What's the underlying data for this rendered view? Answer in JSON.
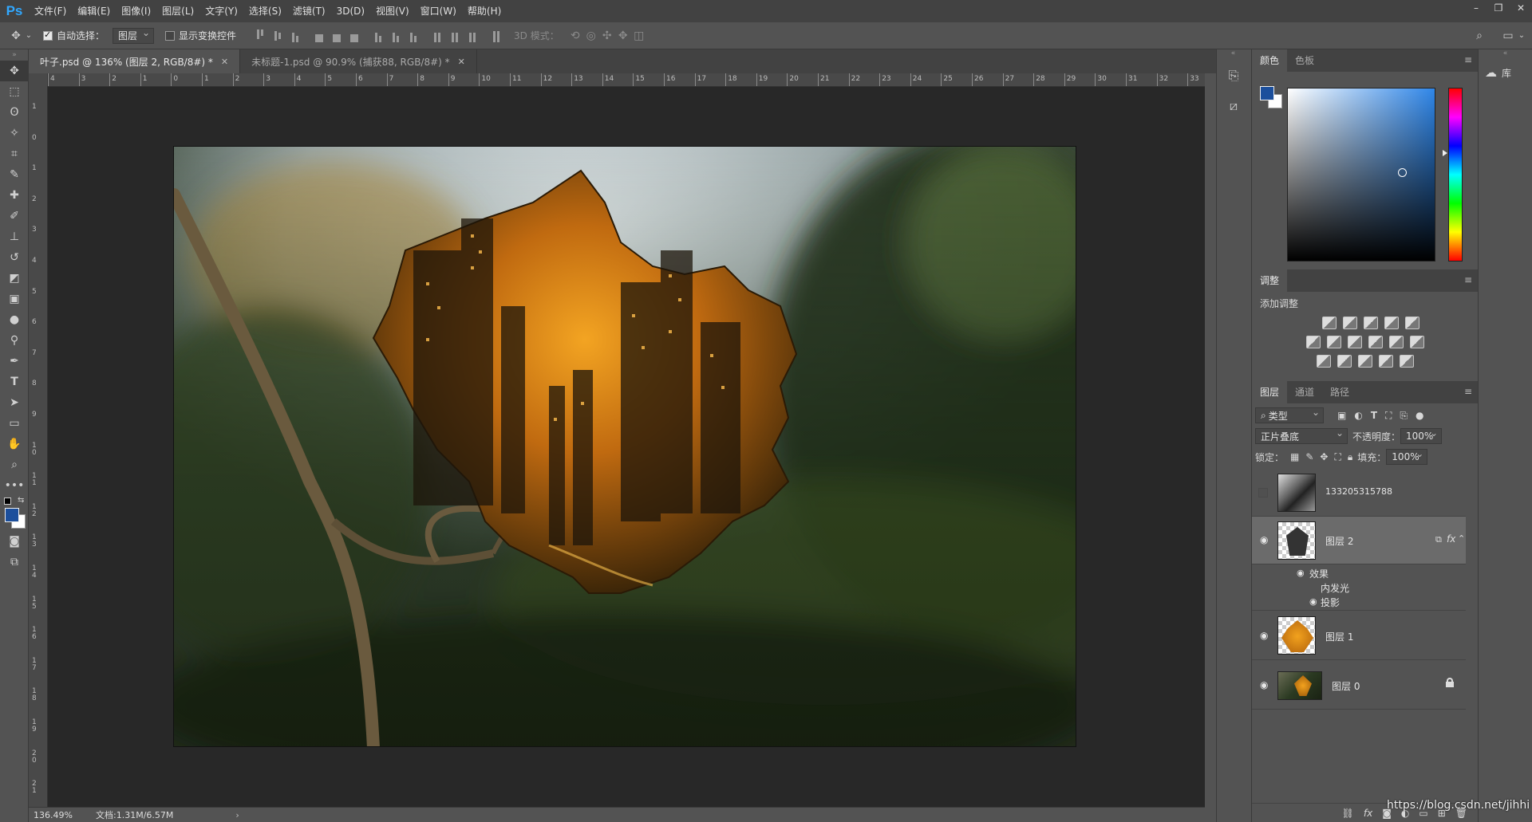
{
  "app": {
    "logo": "Ps"
  },
  "menu": [
    "文件(F)",
    "编辑(E)",
    "图像(I)",
    "图层(L)",
    "文字(Y)",
    "选择(S)",
    "滤镜(T)",
    "3D(D)",
    "视图(V)",
    "窗口(W)",
    "帮助(H)"
  ],
  "window_controls": [
    "–",
    "❐",
    "✕"
  ],
  "options": {
    "auto_select_label": "自动选择：",
    "auto_select_checked": true,
    "auto_select_target": "图层",
    "show_transform_label": "显示变换控件",
    "show_transform_checked": false,
    "mode_3d_label": "3D 模式："
  },
  "tabs": [
    {
      "label": "叶子.psd @ 136% (图层 2, RGB/8#) *",
      "active": true
    },
    {
      "label": "未标题-1.psd @ 90.9% (捕获88, RGB/8#) *",
      "active": false
    }
  ],
  "ruler_h": [
    "4",
    "3",
    "2",
    "1",
    "0",
    "1",
    "2",
    "3",
    "4",
    "5",
    "6",
    "7",
    "8",
    "9",
    "10",
    "11",
    "12",
    "13",
    "14",
    "15",
    "16",
    "17",
    "18",
    "19",
    "20",
    "21",
    "22",
    "23",
    "24",
    "25",
    "26",
    "27",
    "28",
    "29",
    "30",
    "31",
    "32",
    "33"
  ],
  "ruler_v": [
    "1",
    "0",
    "1",
    "2",
    "3",
    "4",
    "5",
    "6",
    "7",
    "8",
    "9",
    "1 0",
    "1 1",
    "1 2",
    "1 3",
    "1 4",
    "1 5",
    "1 6",
    "1 7",
    "1 8",
    "1 9",
    "2 0",
    "2 1"
  ],
  "status": {
    "zoom": "136.49%",
    "doc": "文档:1.31M/6.57M"
  },
  "color_panel": {
    "tabs": [
      "颜色",
      "色板"
    ],
    "foreground": "#1c4f9c",
    "background": "#ffffff",
    "base_hue": "#2f86e8"
  },
  "adjust_panel": {
    "tab": "调整",
    "add_label": "添加调整"
  },
  "layers_panel": {
    "tabs": [
      "图层",
      "通道",
      "路径"
    ],
    "filter_label": "类型",
    "blend_mode": "正片叠底",
    "opacity_label": "不透明度：",
    "opacity": "100%",
    "lock_label": "锁定：",
    "fill_label": "填充：",
    "fill": "100%",
    "layers": [
      {
        "name": "133205315788",
        "visible": false,
        "selected": false
      },
      {
        "name": "图层 2",
        "visible": true,
        "selected": true,
        "effects_label": "效果",
        "effects": [
          "内发光",
          "投影"
        ]
      },
      {
        "name": "图层 1",
        "visible": true,
        "selected": false
      },
      {
        "name": "图层 0",
        "visible": true,
        "selected": false,
        "locked": true
      }
    ]
  },
  "library": {
    "label": "库"
  },
  "watermark": "https://blog.csdn.net/jihhi"
}
